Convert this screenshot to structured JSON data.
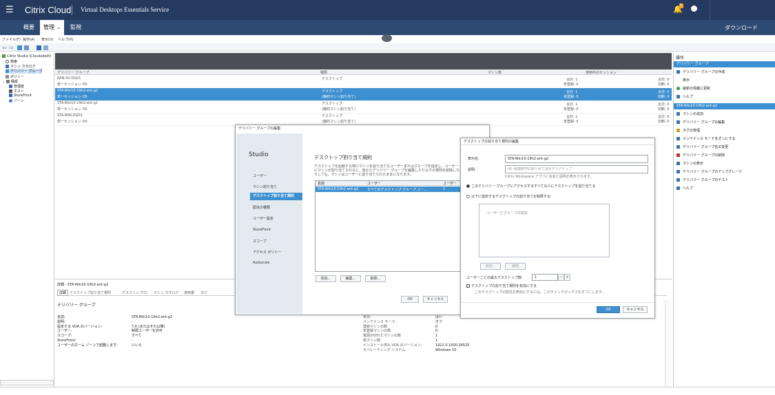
{
  "topbar": {
    "menu_icon": "☰",
    "brand": "Citrix Cloud",
    "service": "Virtual Desktops Essentials Service",
    "notify_count": "1"
  },
  "nav": {
    "tabs": [
      "概要",
      "管理",
      "監視"
    ],
    "download": "ダウンロード"
  },
  "menubar": [
    "ファイル(F)",
    "操作(A)",
    "表示(V)",
    "ヘルプ(H)"
  ],
  "tree": {
    "root": "Citrix Studio (Cloudsdeilt)",
    "items": [
      "検索",
      "マシン カタログ",
      "デリバリー グループ",
      "ポリシー",
      "構成",
      "管理者",
      "ホスト",
      "StoreFront",
      "ゾーン"
    ]
  },
  "grid": {
    "columns": [
      "デリバリー グループ",
      "種類",
      "マシン数",
      "使用中のセッション"
    ],
    "rows": [
      {
        "name": "RAN-SV-DG01",
        "os": "単一セッション OS",
        "type": "デスクトップ",
        "type2": "",
        "m1": "合計: 1",
        "m2": "未登録: 0",
        "s1": "合計: 0",
        "s2": "切断: 0"
      },
      {
        "name": "STA-Win10-19h2-ent-g2",
        "os": "単一セッション OS",
        "type": "デスクトップ",
        "type2": "(静的マシン割り当て)",
        "m1": "合計: 1",
        "m2": "未登録: 0",
        "s1": "合計: 0",
        "s2": "切断: 0"
      },
      {
        "name": "STA-Win10-19h2-ent-g1",
        "os": "単一セッション OS",
        "type": "デスクトップ",
        "type2": "(静的マシン割り当て)",
        "m1": "合計: 1",
        "m2": "未登録: 0",
        "s1": "合計: 0",
        "s2": "切断: 0"
      },
      {
        "name": "STA-WIN-DG01",
        "os": "単一セッション OS",
        "type": "デスクトップ",
        "type2": "(静的マシン割り当て)",
        "m1": "合計: 1",
        "m2": "未登録: 0",
        "s1": "合計: 0",
        "s2": "切断: 0"
      }
    ]
  },
  "details": {
    "title": "詳細 - STA-Win10-19h2-ent-g2",
    "tabs": [
      "詳細",
      "デスクトップ割り当て規則",
      "デスクトップ(1)",
      "マシン カタログ",
      "使用量",
      "タグ"
    ],
    "section": "デリバリー グループ",
    "left": [
      [
        "名前:",
        "STA-Win10-19h2-ent-g2"
      ],
      [
        "説明:",
        "-"
      ],
      [
        "設定する VDA のバージョン:",
        "7.6 (またはそれ以降)"
      ],
      [
        "ユーザー:",
        "制限ユーザーを許可"
      ],
      [
        "スコープ:",
        "すべて"
      ],
      [
        "StoreFront:",
        "-"
      ],
      [
        "ユーザーのホーム ゾーンで起動します:",
        "いいえ"
      ]
    ],
    "right": [
      [
        "有効:",
        "はい"
      ],
      [
        "メンテナンス モード:",
        "オフ"
      ],
      [
        "登録マシンの数",
        "0"
      ],
      [
        "未登録マシンの数",
        "0"
      ],
      [
        "電源が切れたマシンの数",
        "1"
      ],
      [
        "総マシン数:",
        "1"
      ],
      [
        "インストール済み VDA のバージョン:",
        "1912.0.1000.24525"
      ],
      [
        "オペレーティング システム:",
        "Windows 10"
      ]
    ]
  },
  "actions": {
    "title": "操作",
    "group1": "デリバリー グループ",
    "items1": [
      "デリバリー グループの作成",
      "表示",
      "最新の情報に更新",
      "ヘルプ"
    ],
    "group2": "STA-Win10-19h2-ent-g2",
    "items2": [
      "マシンの追加",
      "デリバリー グループの編集",
      "タグの管理",
      "メンテナンス モードをオンにする",
      "デリバリー グループ名の変更",
      "デリバリー グループの削除",
      "マシンの表示",
      "デリバリー グループのアップグレード",
      "デリバリー グループのテスト",
      "ヘルプ"
    ]
  },
  "editDialog": {
    "title": "デリバリー グループの編集",
    "brand": "Studio",
    "steps": [
      "ユーザー",
      "マシン割り当て",
      "デスクトップ割り当て規則",
      "配信の種類",
      "ユーザー設定",
      "StoreFront",
      "スコープ",
      "アクセス ポリシー",
      "Autoscale"
    ],
    "heading": "デスクトップ割り当て規則",
    "desc": "デスクトップを起動する際にマシンを割り当てるユーザーまたはグループを指定し、ユーザーにマシンが割り当てられると、後からデリバリー グループを編集したり以下の規則を削除したりしても、マシンはユーザーに割り当てられたままになります。",
    "table_cols": [
      "名前",
      "ユーザー",
      "ユーザー"
    ],
    "table_row": [
      "STA-Win10-19h2-ent-g2",
      "すべてのデスクトップ グループ ユー...",
      "1"
    ],
    "add": "追加...",
    "edit": "編集...",
    "delete": "削除...",
    "ok": "OK",
    "cancel": "キャンセル"
  },
  "ruleDialog": {
    "title": "デスクトップの割り当て規則の編集",
    "display_label": "表示名:",
    "display_value": "STA-Win10-19h2-ent-g2",
    "desc_label": "説明:",
    "desc_placeholder": "例: 経理部門の割り当て済みデスクトップ",
    "desc_hint": "Citrix Workspace アプリに名前と説明が表示されます。",
    "radio1": "このデリバリー グループにアクセスするすべての人にデスクトップを割り当てる",
    "radio2": "以下に指定するデスクトップの割り当てを制限する:",
    "list_placeholder": "ユーザーとグループの追加",
    "add": "追加...",
    "delete": "削除",
    "max_label": "ユーザーごとの最大デスクトップ数:",
    "max_value": "1",
    "enable_label": "デスクトップの割り当て規則を有効にする",
    "enable_hint": "このデスクトップの配信を無効にするには、このチェックボックスをオフにします。",
    "ok": "OK",
    "cancel": "キャンセル"
  }
}
